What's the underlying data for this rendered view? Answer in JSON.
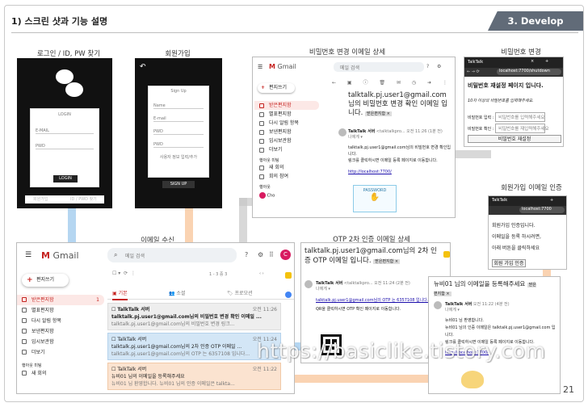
{
  "header": {
    "title": "1) 스크린 샷과 기능 설명",
    "badge": "3. Develop",
    "page_number": "21"
  },
  "captions": {
    "login": "로그인 / ID, PW 찾기",
    "signup": "회원가입",
    "pw_mail": "비밀번호 변경 이메일 상세",
    "pw_change": "비밀번호 변경",
    "mail_inbox": "이메일 수신",
    "otp_mail": "OTP 2차 인증 이메일 상세",
    "signup_mail": "회원가입 이메일 인증"
  },
  "login_screen": {
    "box_title": "LOGIN",
    "email_label": "E-MAIL",
    "pwd_label": "PWD",
    "login_button": "LOGIN",
    "link_left": "회원가입",
    "link_right": "ID / PWD 찾기"
  },
  "signup_screen": {
    "title": "Sign Up",
    "fields": [
      "Name",
      "E-mail",
      "PWD",
      "PWD"
    ],
    "note": "사용자 정보 입력/추가",
    "button": "SIGN UP"
  },
  "gmail_small": {
    "logo": "Gmail",
    "search_placeholder": "메일 검색",
    "compose": "편지쓰기",
    "side": [
      "받은편지함",
      "별표편지함",
      "다시 알림 항목",
      "보낸편지함",
      "임시보관함",
      "더보기"
    ],
    "meet_title": "행아웃 미팅",
    "meet_items": [
      "새 회의",
      "회의 참여"
    ],
    "hangout_title": "행아웃",
    "user": "Cho",
    "subject": "talktalk.pj.user1@gmail.com님의 비밀번호 변경 확인 이메일 입니다.",
    "label": "받은편지함 ×",
    "sender": "TalkTalk 서버",
    "sender_addr": "<talktalkpro...",
    "time": "오전 11:26 (1분 전)",
    "to": "나에게 ▾",
    "body1": "talktalk.pj.user1@gmail.com님의 비밀번호 변경 확인입니다.",
    "body2": "링크를 클릭하시면 이메일 등록 페이지로 이동합니다.",
    "link": "http://localhost:7700/",
    "password_label": "PASSWORD"
  },
  "pw_change_page": {
    "tab": "TalkTalk",
    "url": "localhost:7700/shutdown",
    "heading": "비밀번호 재설정 페이지 입니다.",
    "note": "10자 이상의 비밀번호를 입력해주세요.",
    "rows": [
      {
        "label": "비밀번호 입력 :",
        "placeholder": "비밀번호를 입력해주세요"
      },
      {
        "label": "비밀번호 확인 :",
        "placeholder": "비밀번호를 재입력해주세요"
      }
    ],
    "button": "비밀번호 재설정"
  },
  "gmail_big": {
    "logo": "Gmail",
    "search_placeholder": "메일 검색",
    "compose": "편지쓰기",
    "count": "1",
    "pagination": "1 - 3 중 3",
    "tabs": [
      "기본",
      "소셜",
      "프로모션"
    ],
    "side": [
      "받은편지함",
      "별표편지함",
      "다시 알림 항목",
      "보낸편지함",
      "임시보관함",
      "더보기"
    ],
    "meet_title": "행아웃 미팅",
    "meet_items": [
      "새 회의"
    ],
    "rows": [
      {
        "sender": "TalkTalk 서버",
        "time": "오전 11:26",
        "subject": "talktalk.pj.user1@gmail.com님의 비밀번호 변경 확인 이메일 ...",
        "snippet": "talktalk.pj.user1@gmail.com님의 비밀번호 변경 링크..."
      },
      {
        "sender": "TalkTalk 서버",
        "time": "오전 11:24",
        "subject": "talktalk.pj.user1@gmail.com님의 2차 인증 OTP 이메일 ...",
        "snippet": "talktalk.pj.user1@gmail.com님의 OTP 는 6357108 입니다..."
      },
      {
        "sender": "TalkTalk 서버",
        "time": "오전 11:22",
        "subject": "뉴비01 님의 이메일을 등록해주세요",
        "snippet": "뉴비01 님 환영합니다. 뉴비01 님의 인증 이메일은 talkta..."
      }
    ]
  },
  "otp_mail": {
    "subject": "talktalk.pj.user1@gmail.com님의 2차 인증 OTP 이메일 입니다.",
    "label": "받은편지함 ×",
    "sender": "TalkTalk 서버",
    "sender_addr": "<talktalkpro...",
    "time": "오전 11:24 (2분 전)",
    "to": "나에게 ▾",
    "body1": "talktalk.pj.user1@gmail.com님의 OTP 는 6357108 입니다.",
    "body2": "QR을 클릭하시면 OTP 확인 페이지로 이동합니다."
  },
  "signup_mail": {
    "subject": "뉴비01 님의 이메일을 등록해주세요",
    "label": "받은편지함 ×",
    "sender": "TalkTalk 서버",
    "time": "오전 11:22 (4분 전)",
    "to": "나에게 ▾",
    "body1": "뉴비01 님 환영합니다.",
    "body2": "뉴비01 님의 인증 이메일은 talktalk.pj.user1@gmail.com 입니다.",
    "body3": "링크를 클릭하시면 이메일 등록 페이지로 이동합니다.",
    "link": "http://localhost:7700/"
  },
  "signup_confirm": {
    "tab": "TalkTalk",
    "url": "localhost:7700",
    "lines": [
      "회원가입 인증입니다.",
      "이메일을 등록 하시려면,",
      "아래 버튼을 클릭하세요"
    ],
    "button": "회원 가입 인증"
  },
  "watermark": "https://basiclike.tistory.com",
  "colors": {
    "badge": "#616b78",
    "gmail_red": "#c5221f",
    "blue_arrow": "#78b4e6",
    "orange_arrow": "#f5af73"
  }
}
